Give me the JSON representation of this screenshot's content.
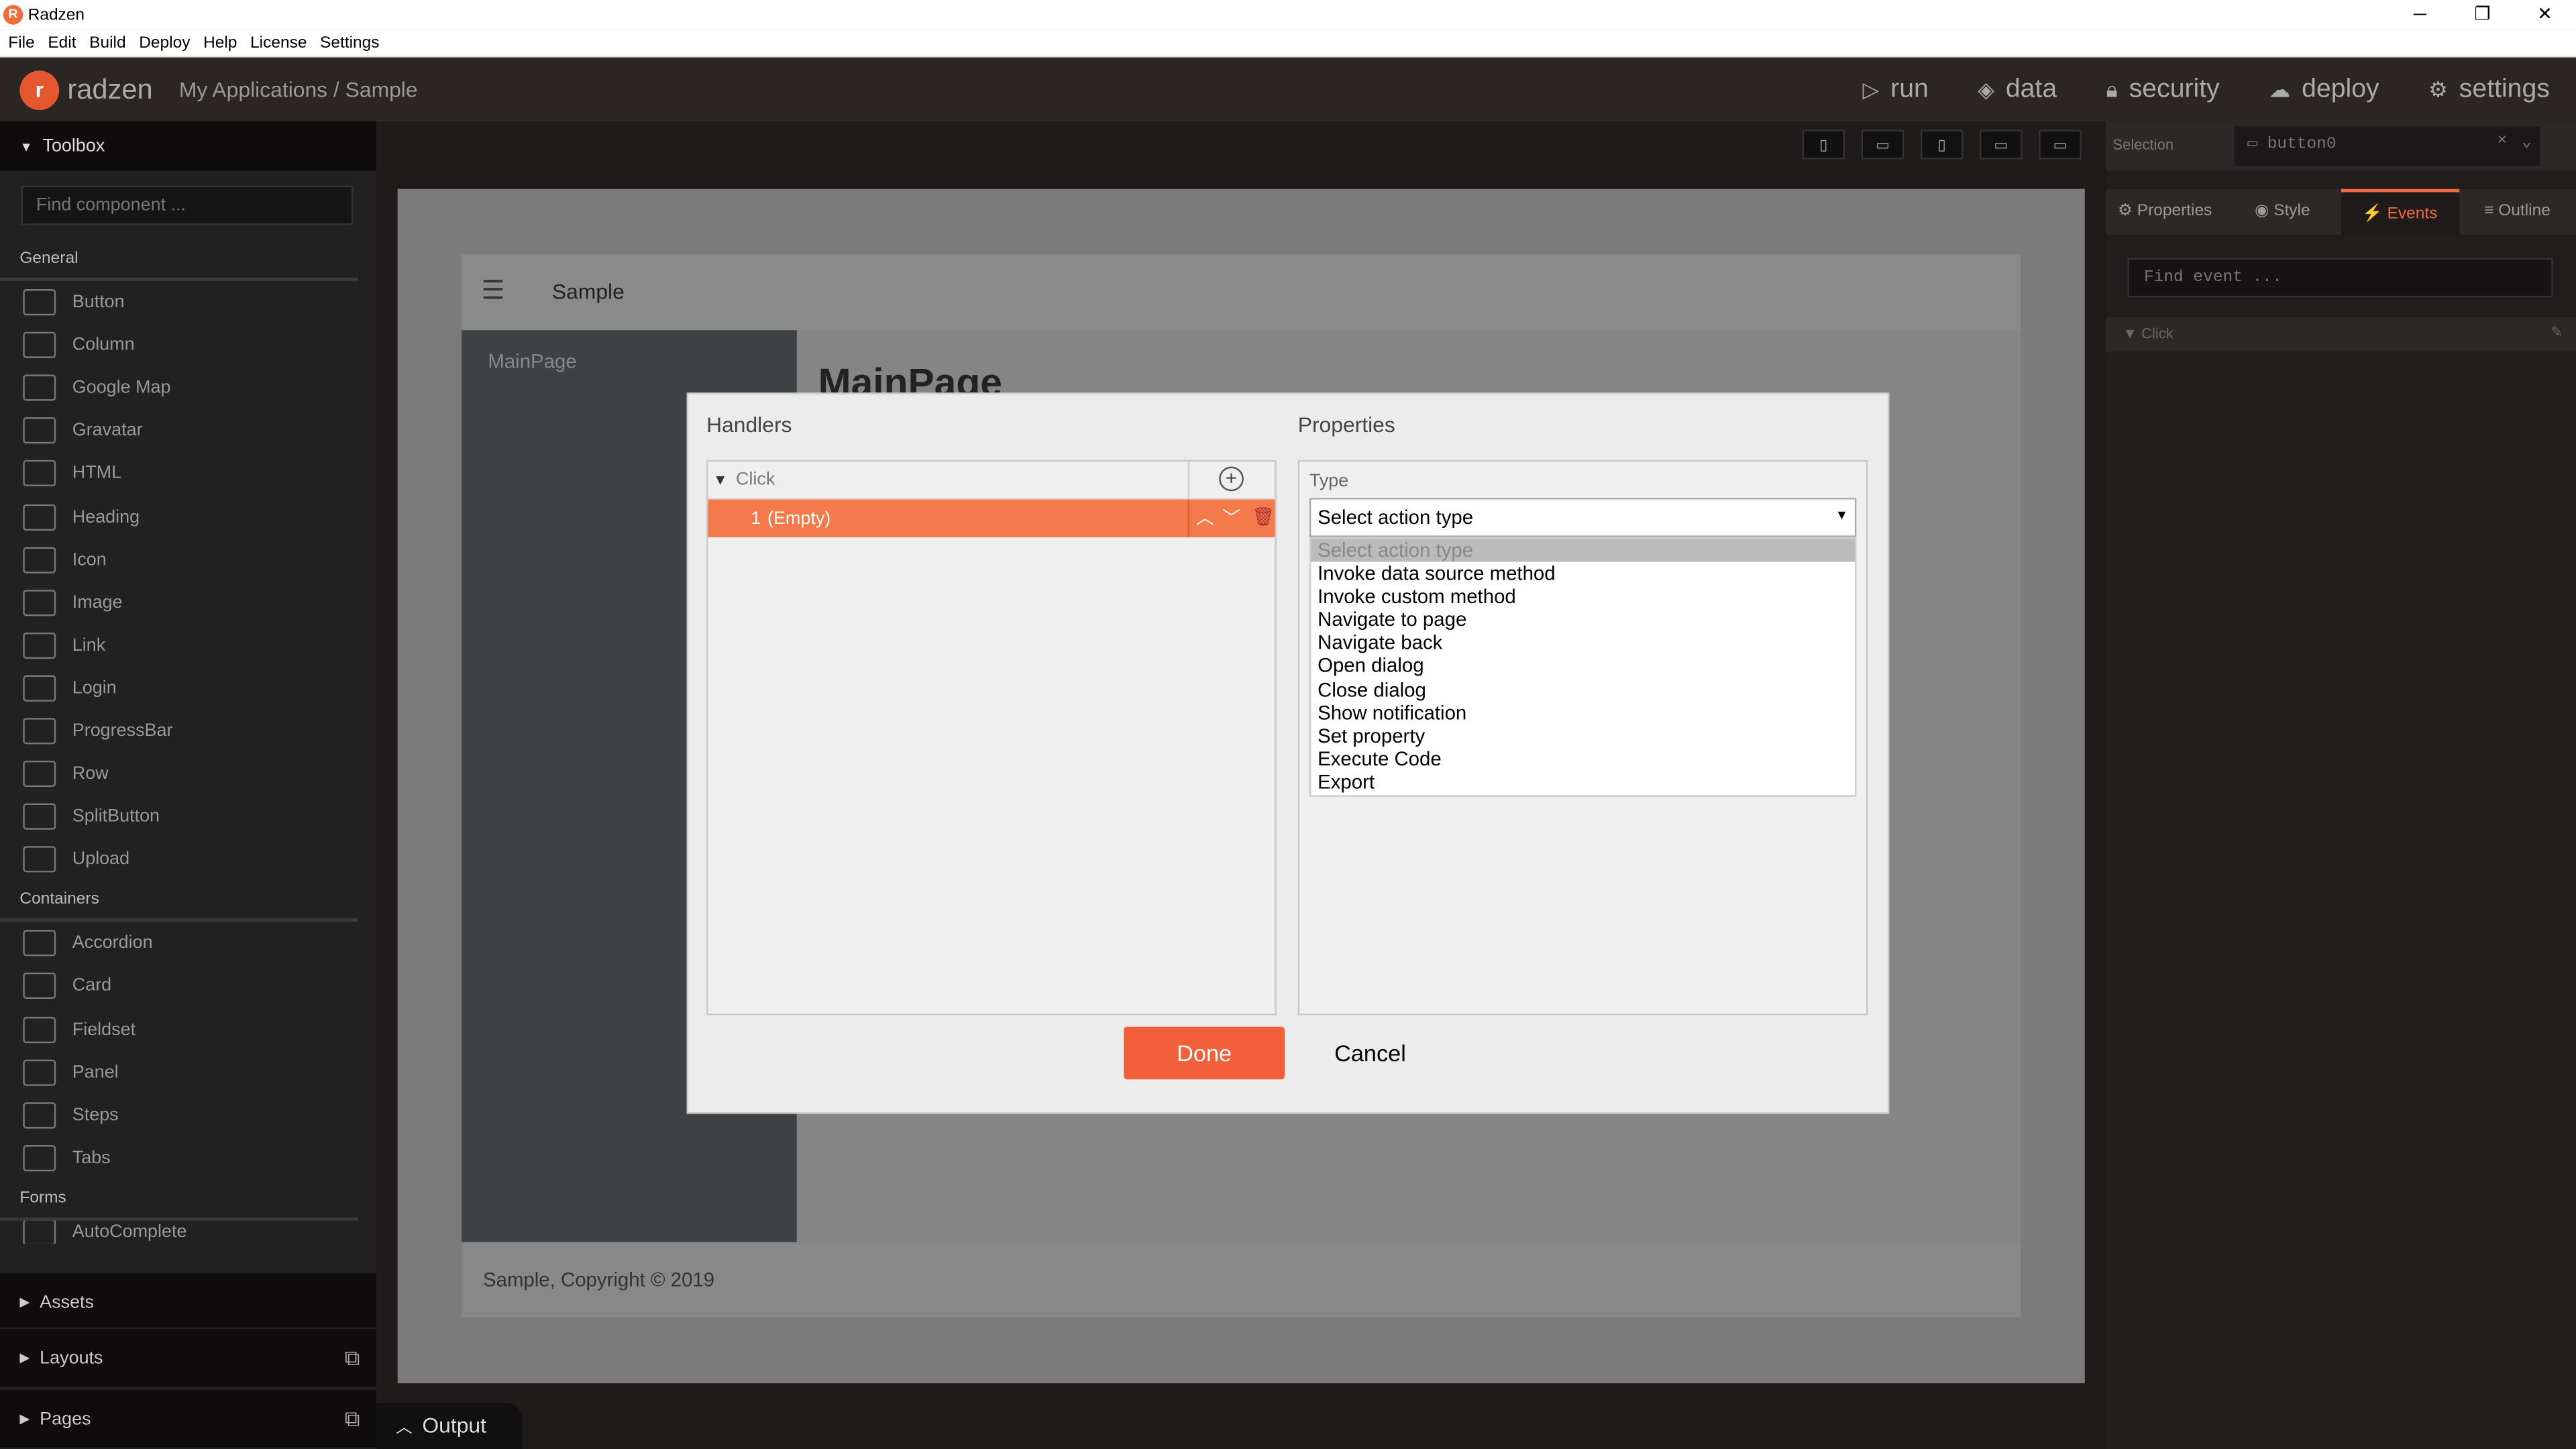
{
  "window": {
    "title": "Radzen",
    "minimize": "─",
    "restore": "❐",
    "close": "✕"
  },
  "menu": [
    "File",
    "Edit",
    "Build",
    "Deploy",
    "Help",
    "License",
    "Settings"
  ],
  "topnav": {
    "logo_text": "radzen",
    "breadcrumb": "My Applications / Sample",
    "items": [
      {
        "label": "run",
        "icon": "play-icon"
      },
      {
        "label": "data",
        "icon": "layers-icon"
      },
      {
        "label": "security",
        "icon": "lock-icon"
      },
      {
        "label": "deploy",
        "icon": "cloud-upload-icon"
      },
      {
        "label": "settings",
        "icon": "gear-icon"
      }
    ]
  },
  "toolbox": {
    "title": "Toolbox",
    "search_placeholder": "Find component ...",
    "general_label": "General",
    "general": [
      "Button",
      "Column",
      "Google Map",
      "Gravatar",
      "HTML",
      "Heading",
      "Icon",
      "Image",
      "Link",
      "Login",
      "ProgressBar",
      "Row",
      "SplitButton",
      "Upload"
    ],
    "containers_label": "Containers",
    "containers": [
      "Accordion",
      "Card",
      "Fieldset",
      "Panel",
      "Steps",
      "Tabs"
    ],
    "forms_label": "Forms",
    "cut_item": "AutoComplete",
    "footer": [
      "Assets",
      "Layouts",
      "Pages"
    ]
  },
  "preview": {
    "header_title": "Sample",
    "side_item": "MainPage",
    "heading": "MainPage",
    "footer": "Sample, Copyright © 2019"
  },
  "dialog": {
    "handlers_title": "Handlers",
    "properties_title": "Properties",
    "event": "Click",
    "handler_index": "1",
    "handler_label": "(Empty)",
    "type_label": "Type",
    "select_value": "Select action type",
    "options": [
      "Select action type",
      "Invoke data source method",
      "Invoke custom method",
      "Navigate to page",
      "Navigate back",
      "Open dialog",
      "Close dialog",
      "Show notification",
      "Set property",
      "Execute Code",
      "Export"
    ],
    "done": "Done",
    "cancel": "Cancel"
  },
  "right_panel": {
    "selection_label": "Selection",
    "selection_value": "button0",
    "tabs": [
      "Properties",
      "Style",
      "Events",
      "Outline"
    ],
    "active_tab": "Events",
    "find_event_placeholder": "Find event ...",
    "event_row": "Click"
  },
  "output": {
    "label": "Output"
  },
  "colors": {
    "accent": "#f25f3a",
    "selected_row": "#f47a4b"
  }
}
